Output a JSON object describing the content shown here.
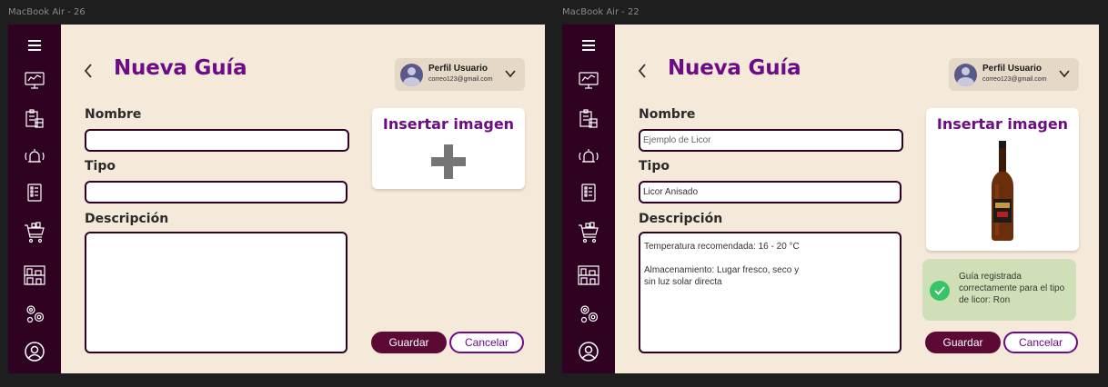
{
  "frames": [
    {
      "label": "MacBook Air - 26",
      "title": "Nueva Guía",
      "profile": {
        "name": "Perfil Usuario",
        "email": "correo123@gmail.com"
      },
      "form": {
        "name_label": "Nombre",
        "name_value": "",
        "type_label": "Tipo",
        "type_value": "",
        "description_label": "Descripción",
        "description_value": ""
      },
      "image_card": {
        "title": "Insertar imagen",
        "icon": "plus-icon"
      },
      "buttons": {
        "save": "Guardar",
        "cancel": "Cancelar"
      }
    },
    {
      "label": "MacBook Air - 22",
      "title": "Nueva Guía",
      "profile": {
        "name": "Perfil Usuario",
        "email": "correo123@gmail.com"
      },
      "form": {
        "name_label": "Nombre",
        "name_value": "",
        "name_placeholder": "Ejemplo de Licor",
        "type_label": "Tipo",
        "type_value": "Licor Anisado",
        "description_label": "Descripción",
        "description_value": "Temperatura recomendada: 16 - 20 °C\n\nAlmacenamiento: Lugar fresco, seco y\nsin luz solar directa"
      },
      "image_card": {
        "title": "Insertar imagen",
        "icon": "rum-bottle-image"
      },
      "toast": {
        "text": "Guía registrada correctamente para el tipo de licor: Ron",
        "icon": "check-circle-icon"
      },
      "buttons": {
        "save": "Guardar",
        "cancel": "Cancelar"
      }
    }
  ],
  "sidebar_icons": [
    "menu-icon",
    "dashboard-icon",
    "inventory-icon",
    "alarm-icon",
    "checklist-icon",
    "cart-icon",
    "warehouse-icon",
    "settings-icon",
    "user-icon"
  ],
  "colors": {
    "sidebar": "#2e0220",
    "accent": "#6e0c86",
    "save": "#5c0a35",
    "background": "#f5ead9"
  }
}
